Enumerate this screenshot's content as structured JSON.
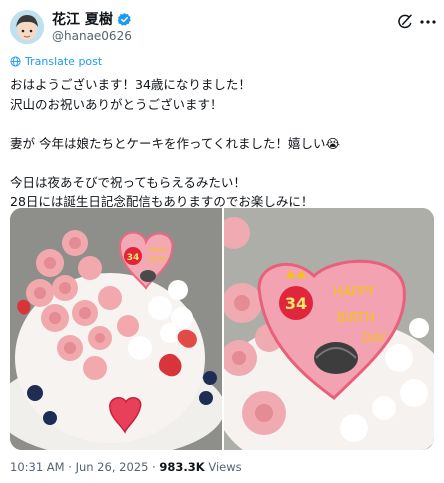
{
  "post": {
    "display_name": "花江 夏樹",
    "handle": "@hanae0626",
    "translate_label": "Translate post",
    "lines": [
      "おはようございます！34歳になりました！",
      "沢山のお祝いありがとうございます！",
      "",
      "妻が 今年は娘たちとケーキを作ってくれました！嬉しい😭",
      "",
      "今日は夜あそびで祝ってもらえるみたい！",
      "28日には誕生日記念配信もありますのでお楽しみに！"
    ],
    "time": "10:31 AM",
    "separator": " · ",
    "date": "Jun 26, 2025",
    "views_count": "983.3K",
    "views_label": "Views"
  },
  "images": {
    "cake_text_happy": "HAPPY",
    "cake_text_birth": "BIRTH",
    "cake_text_day": "DAY",
    "cake_number": "34"
  },
  "icons": {
    "verified": "verified-badge-icon",
    "grok": "grok-icon",
    "more": "more-icon",
    "translate": "globe-icon"
  },
  "colors": {
    "verified": "#1d9bf0",
    "link": "#1d9bf0",
    "secondary_text": "#536471"
  }
}
